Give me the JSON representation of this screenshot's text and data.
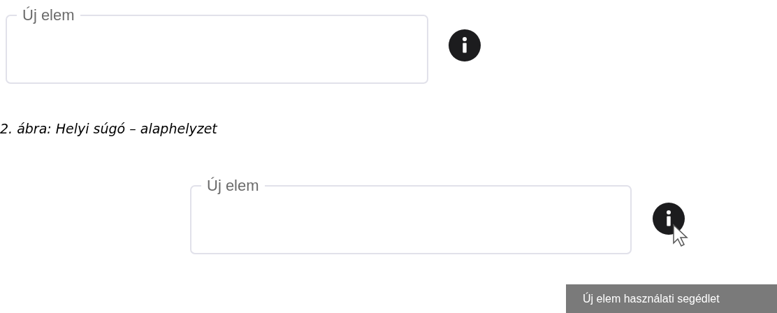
{
  "figure_1": {
    "field": {
      "label": "Új elem"
    }
  },
  "caption": "2. ábra: Helyi súgó – alaphelyzet",
  "figure_2": {
    "field": {
      "label": "Új elem"
    },
    "tooltip": "Új elem használati segédlet"
  }
}
